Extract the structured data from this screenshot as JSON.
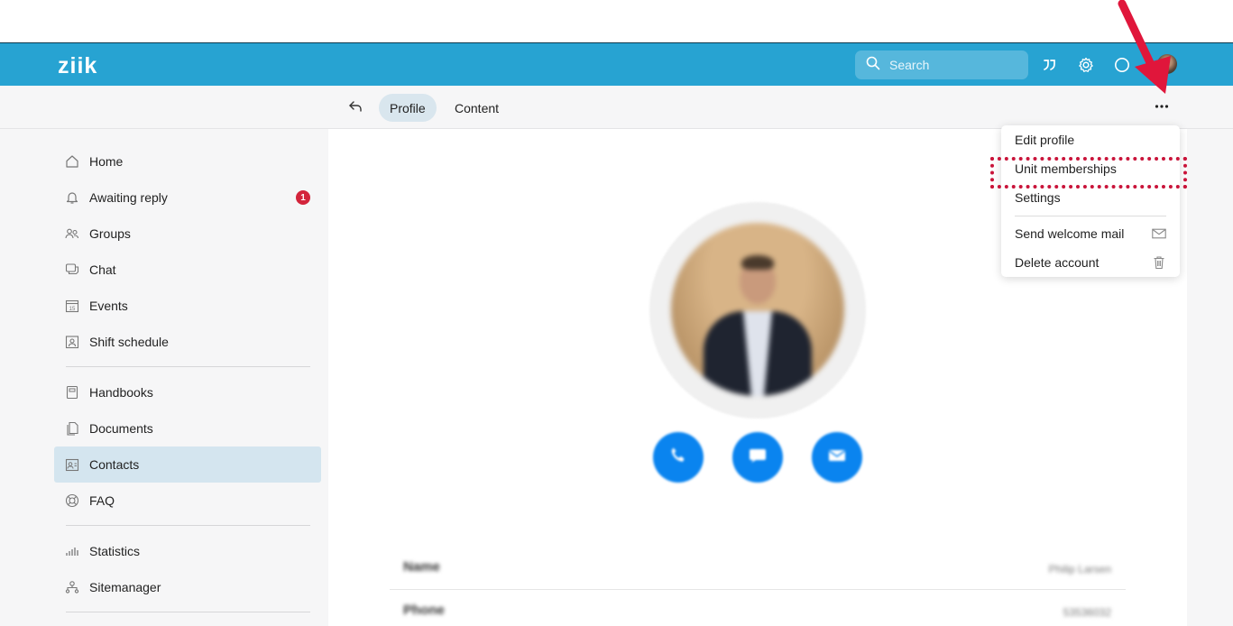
{
  "app": {
    "logo_text": "ziik",
    "accent_color": "#27a3d2"
  },
  "header": {
    "search_placeholder": "Search",
    "icons": [
      "search-icon",
      "quote-icon",
      "gear-icon",
      "help-icon"
    ]
  },
  "subnav": {
    "tabs": [
      {
        "label": "Profile",
        "active": true
      },
      {
        "label": "Content",
        "active": false
      }
    ]
  },
  "sidebar": {
    "items": [
      {
        "label": "Home",
        "icon": "home-icon"
      },
      {
        "label": "Awaiting reply",
        "icon": "bell-icon",
        "badge": "1"
      },
      {
        "label": "Groups",
        "icon": "groups-icon"
      },
      {
        "label": "Chat",
        "icon": "chat-icon"
      },
      {
        "label": "Events",
        "icon": "calendar-icon",
        "icon_text": "15"
      },
      {
        "label": "Shift schedule",
        "icon": "shift-icon"
      },
      {
        "label": "Handbooks",
        "icon": "book-icon"
      },
      {
        "label": "Documents",
        "icon": "documents-icon"
      },
      {
        "label": "Contacts",
        "icon": "contacts-icon",
        "active": true
      },
      {
        "label": "FAQ",
        "icon": "lifebuoy-icon"
      },
      {
        "label": "Statistics",
        "icon": "statistics-icon"
      },
      {
        "label": "Sitemanager",
        "icon": "sitemap-icon"
      }
    ]
  },
  "profile": {
    "actions": [
      "phone-icon",
      "chat-icon",
      "mail-icon"
    ],
    "fields": [
      {
        "label": "Name",
        "value": "Philip Larsen"
      },
      {
        "label": "Phone",
        "value": "53536032"
      }
    ]
  },
  "menu": {
    "items": [
      {
        "label": "Edit profile"
      },
      {
        "label": "Unit memberships",
        "highlighted": true
      },
      {
        "label": "Settings"
      },
      {
        "label": "Send welcome mail",
        "icon": "mail-icon"
      },
      {
        "label": "Delete account",
        "icon": "trash-icon"
      }
    ]
  },
  "annotation": {
    "highlight_color": "#c9143a",
    "arrow_color": "#e0163b"
  }
}
